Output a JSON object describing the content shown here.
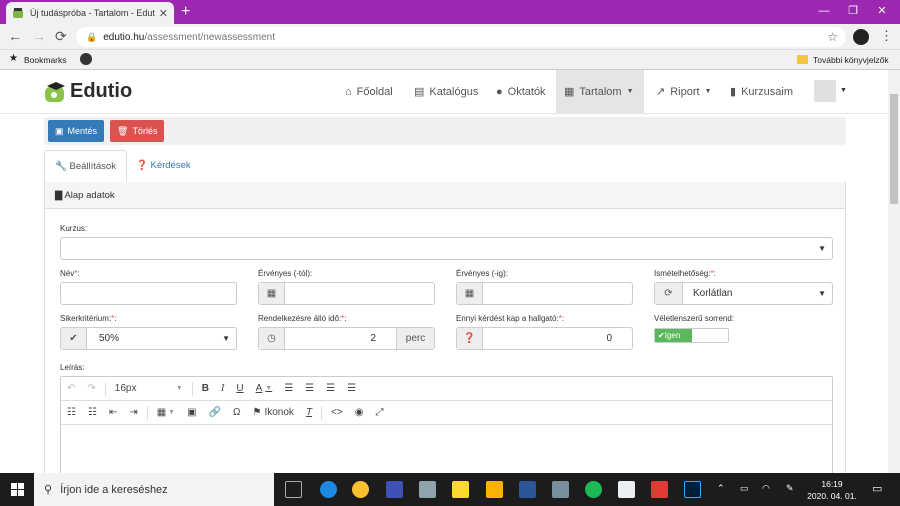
{
  "browser": {
    "tab_title": "Új tudáspróba - Tartalom - Edutio",
    "new_tab": "+",
    "url_host": "edutio.hu",
    "url_path": "/assessment/newassessment",
    "bookmarks_label": "Bookmarks",
    "other_bookmarks": "További könyvjelzők",
    "colors": {
      "tab_strip": "#9c27b0"
    }
  },
  "site": {
    "logo": "Edutio",
    "nav": [
      {
        "label": "Főoldal",
        "icon": "home-icon"
      },
      {
        "label": "Katalógus",
        "icon": "list-icon"
      },
      {
        "label": "Oktatók",
        "icon": "user-icon"
      },
      {
        "label": "Tartalom",
        "icon": "film-icon",
        "active": true
      },
      {
        "label": "Riport",
        "icon": "chart-icon"
      },
      {
        "label": "Kurzusaim",
        "icon": "bookmark-icon"
      }
    ]
  },
  "toolbar": {
    "save": "Mentés",
    "delete": "Törlés",
    "colors": {
      "save": "#337ab7",
      "delete": "#d9534f"
    }
  },
  "tabs": {
    "settings": "Beállítások",
    "questions": "Kérdések"
  },
  "panel": {
    "title": "Alap adatok"
  },
  "form": {
    "course_label": "Kurzus:",
    "name_label": "Név",
    "valid_from_label": "Érvényes (-tól):",
    "valid_to_label": "Érvényes (-ig):",
    "repeat_label": "Ismételhetőség:",
    "repeat_value": "Korlátlan",
    "success_label": "Sikerkritérium:",
    "success_value": "50%",
    "time_label": "Rendelkezésre álló idő:",
    "time_value": "2",
    "time_unit": "perc",
    "questions_label": "Ennyi kérdést kap a hallgató:",
    "questions_value": "0",
    "random_label": "Véletlenszerű sorrend:",
    "random_value": "Igen",
    "required_mark": "*",
    "desc_label": "Leírás:"
  },
  "editor": {
    "font_size": "16px",
    "icons_label": "Ikonok"
  },
  "taskbar": {
    "search_placeholder": "Írjon ide a kereséshez",
    "time": "16:19",
    "date": "2020. 04. 01."
  }
}
